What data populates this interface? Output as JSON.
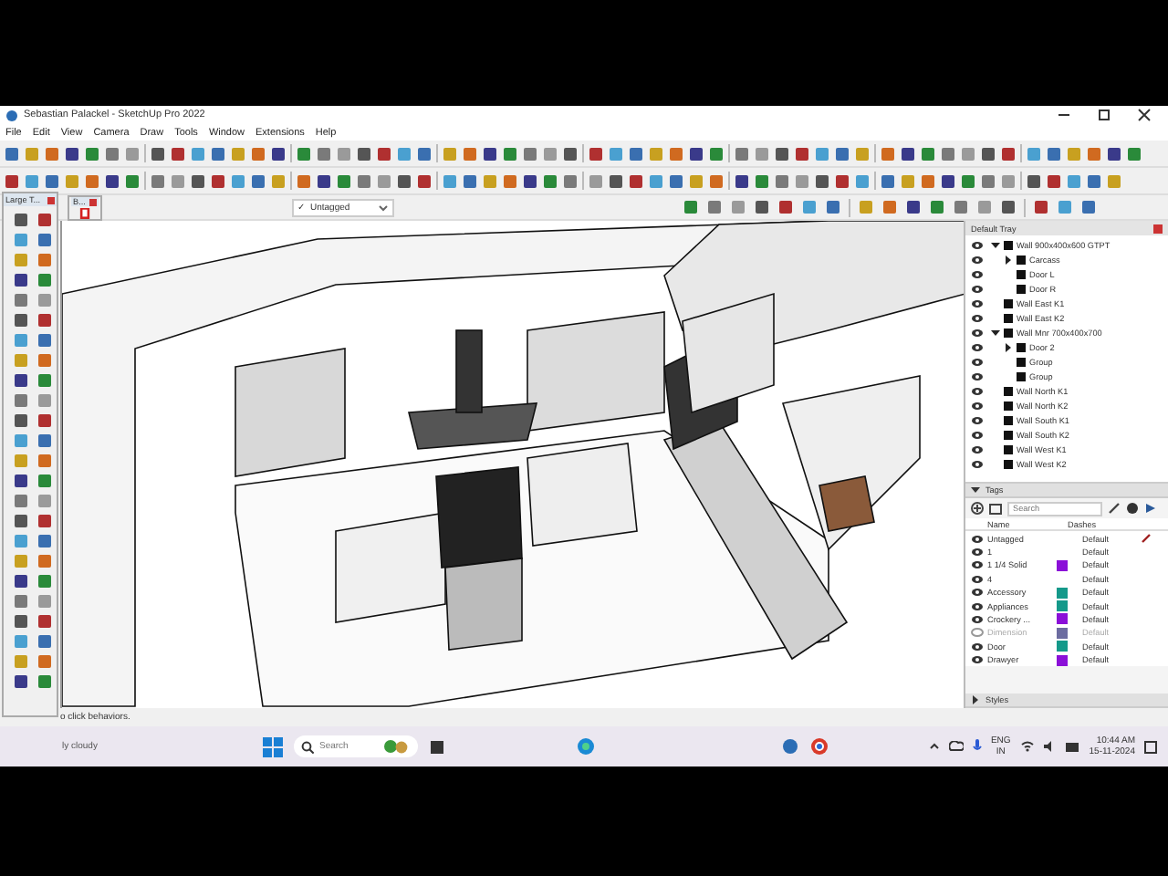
{
  "window": {
    "title": "Sebastian Palackel - SketchUp Pro 2022"
  },
  "menu": [
    "File",
    "Edit",
    "View",
    "Camera",
    "Draw",
    "Tools",
    "Window",
    "Extensions",
    "Help"
  ],
  "tag_dropdown": {
    "check": "✓",
    "value": "Untagged"
  },
  "large_toolset": {
    "title": "Large T..."
  },
  "small_toolbar": {
    "title": "B..."
  },
  "tray": {
    "title": "Default Tray",
    "outliner": [
      {
        "name": "Wall 900x400x600 GTPT",
        "expanded": true,
        "children": [
          {
            "name": "Carcass",
            "expanded": false
          },
          {
            "name": "Door L"
          },
          {
            "name": "Door R"
          }
        ]
      },
      {
        "name": "Wall East K1"
      },
      {
        "name": "Wall East K2"
      },
      {
        "name": "Wall Mnr 700x400x700",
        "expanded": true,
        "children": [
          {
            "name": "Door 2",
            "expanded": false
          },
          {
            "name": "Group"
          },
          {
            "name": "Group"
          }
        ]
      },
      {
        "name": "Wall North K1"
      },
      {
        "name": "Wall North K2"
      },
      {
        "name": "Wall South K1"
      },
      {
        "name": "Wall South K2"
      },
      {
        "name": "Wall West K1"
      },
      {
        "name": "Wall West K2"
      }
    ],
    "tags": {
      "title": "Tags",
      "expanded": true,
      "search": {
        "placeholder": "Search"
      },
      "columns": [
        "Name",
        "Dashes"
      ],
      "rows": [
        {
          "name": "Untagged",
          "visible": true,
          "active": true,
          "dashes": "Default"
        },
        {
          "name": "1",
          "visible": true,
          "active": false,
          "dashes": "Default"
        },
        {
          "name": "1 1/4 Solid",
          "visible": true,
          "active": false,
          "color": "#8b10d8",
          "dashes": "Default"
        },
        {
          "name": "4",
          "visible": true,
          "active": false,
          "dashes": "Default"
        },
        {
          "name": "Accessory",
          "visible": true,
          "active": false,
          "color": "#14998a",
          "dashes": "Default"
        },
        {
          "name": "Appliances",
          "visible": true,
          "active": false,
          "color": "#14998a",
          "dashes": "Default"
        },
        {
          "name": "Crockery ...",
          "visible": true,
          "active": false,
          "color": "#8b10d8",
          "dashes": "Default"
        },
        {
          "name": "Dimension",
          "visible": false,
          "active": false,
          "color": "#6c6ca0",
          "dashes": "Default"
        },
        {
          "name": "Door",
          "visible": true,
          "active": false,
          "color": "#14998a",
          "dashes": "Default"
        },
        {
          "name": "Drawyer",
          "visible": true,
          "active": false,
          "color": "#8b10d8",
          "dashes": "Default"
        }
      ]
    },
    "styles": {
      "title": "Styles",
      "expanded": false
    }
  },
  "status_bar": {
    "hint": "o click behaviors."
  },
  "taskbar": {
    "weather": "ly cloudy",
    "search": {
      "placeholder": "Search"
    },
    "language": "ENG",
    "region": "IN",
    "time": "10:44 AM",
    "date": "15-11-2024"
  }
}
